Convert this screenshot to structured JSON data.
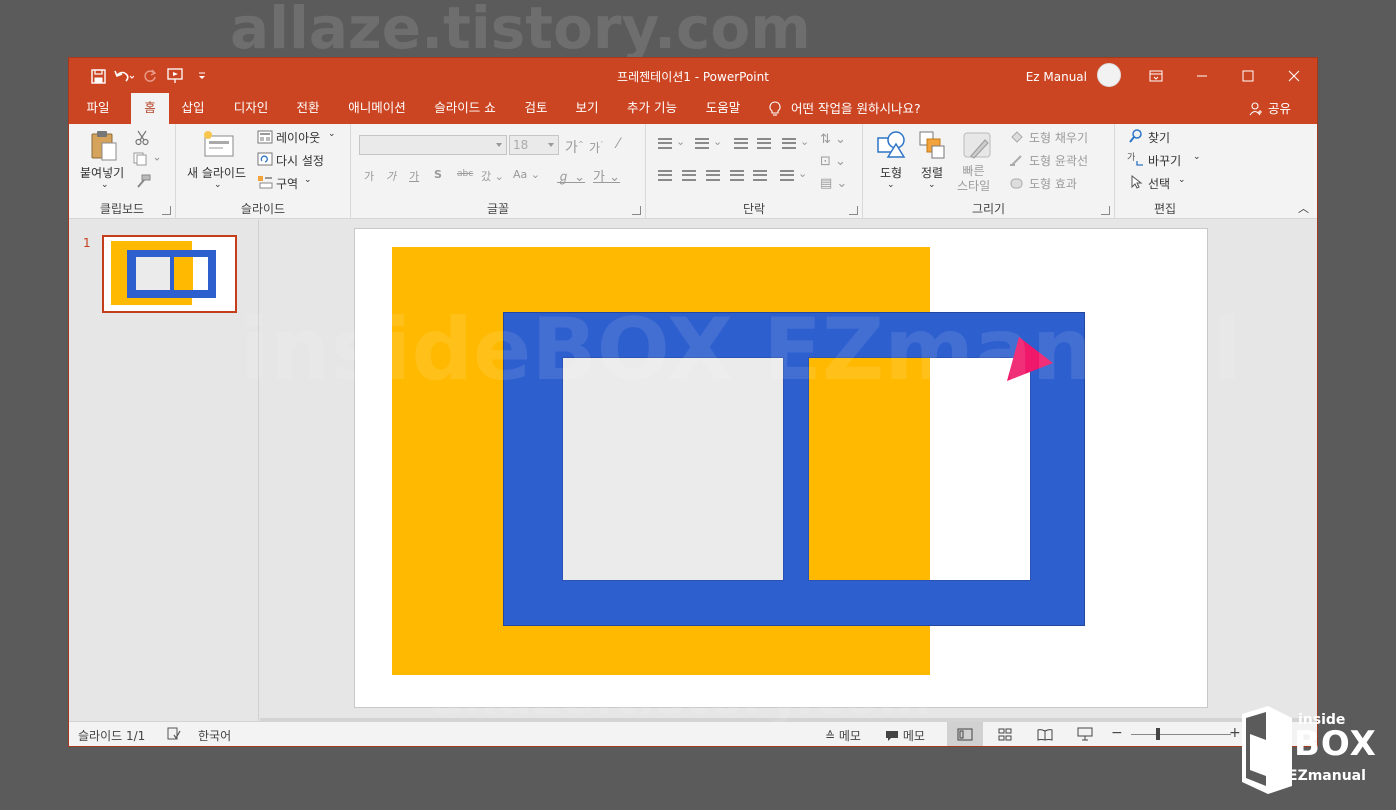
{
  "window": {
    "title": "프레젠테이션1  -  PowerPoint",
    "user_name": "Ez Manual"
  },
  "tabs": [
    {
      "label": "파일"
    },
    {
      "label": "홈"
    },
    {
      "label": "삽입"
    },
    {
      "label": "디자인"
    },
    {
      "label": "전환"
    },
    {
      "label": "애니메이션"
    },
    {
      "label": "슬라이드 쇼"
    },
    {
      "label": "검토"
    },
    {
      "label": "보기"
    },
    {
      "label": "추가 기능"
    },
    {
      "label": "도움말"
    }
  ],
  "tell_me": "어떤 작업을 원하시나요?",
  "share": "공유",
  "ribbon": {
    "clipboard": {
      "paste": "붙여넣기",
      "label": "클립보드"
    },
    "slides": {
      "new_slide": "새 슬라이드",
      "layout": "레이아웃",
      "reset": "다시 설정",
      "section": "구역",
      "label": "슬라이드"
    },
    "font": {
      "font_size": "18",
      "label": "글꼴"
    },
    "paragraph": {
      "label": "단락"
    },
    "drawing": {
      "shapes": "도형",
      "arrange": "정렬",
      "quick_styles": "빠른\n스타일",
      "shape_fill": "도형 채우기",
      "shape_outline": "도형 윤곽선",
      "shape_effects": "도형 효과",
      "label": "그리기"
    },
    "editing": {
      "find": "찾기",
      "replace": "바꾸기",
      "select": "선택",
      "label": "편집"
    }
  },
  "thumbnail": {
    "number": "1"
  },
  "status": {
    "slide_count": "슬라이드 1/1",
    "language": "한국어",
    "notes": "메모",
    "comments": "메모",
    "zoom_minus": "−",
    "zoom_plus": "+"
  },
  "watermarks": {
    "top": "allaze.tistory.com",
    "middle": "insideBOX EZmanual",
    "bottom": "allaze.tistory.com",
    "logo_inside": "inside",
    "logo_box": "BOX",
    "logo_ez": "EZmanual"
  },
  "colors": {
    "title_bar": "#cc4523",
    "yellow_shape": "#ffb900",
    "blue_frame": "#2e5fcf",
    "inner_gray": "#ebebeb",
    "pointer_pink": "#f0186a"
  }
}
